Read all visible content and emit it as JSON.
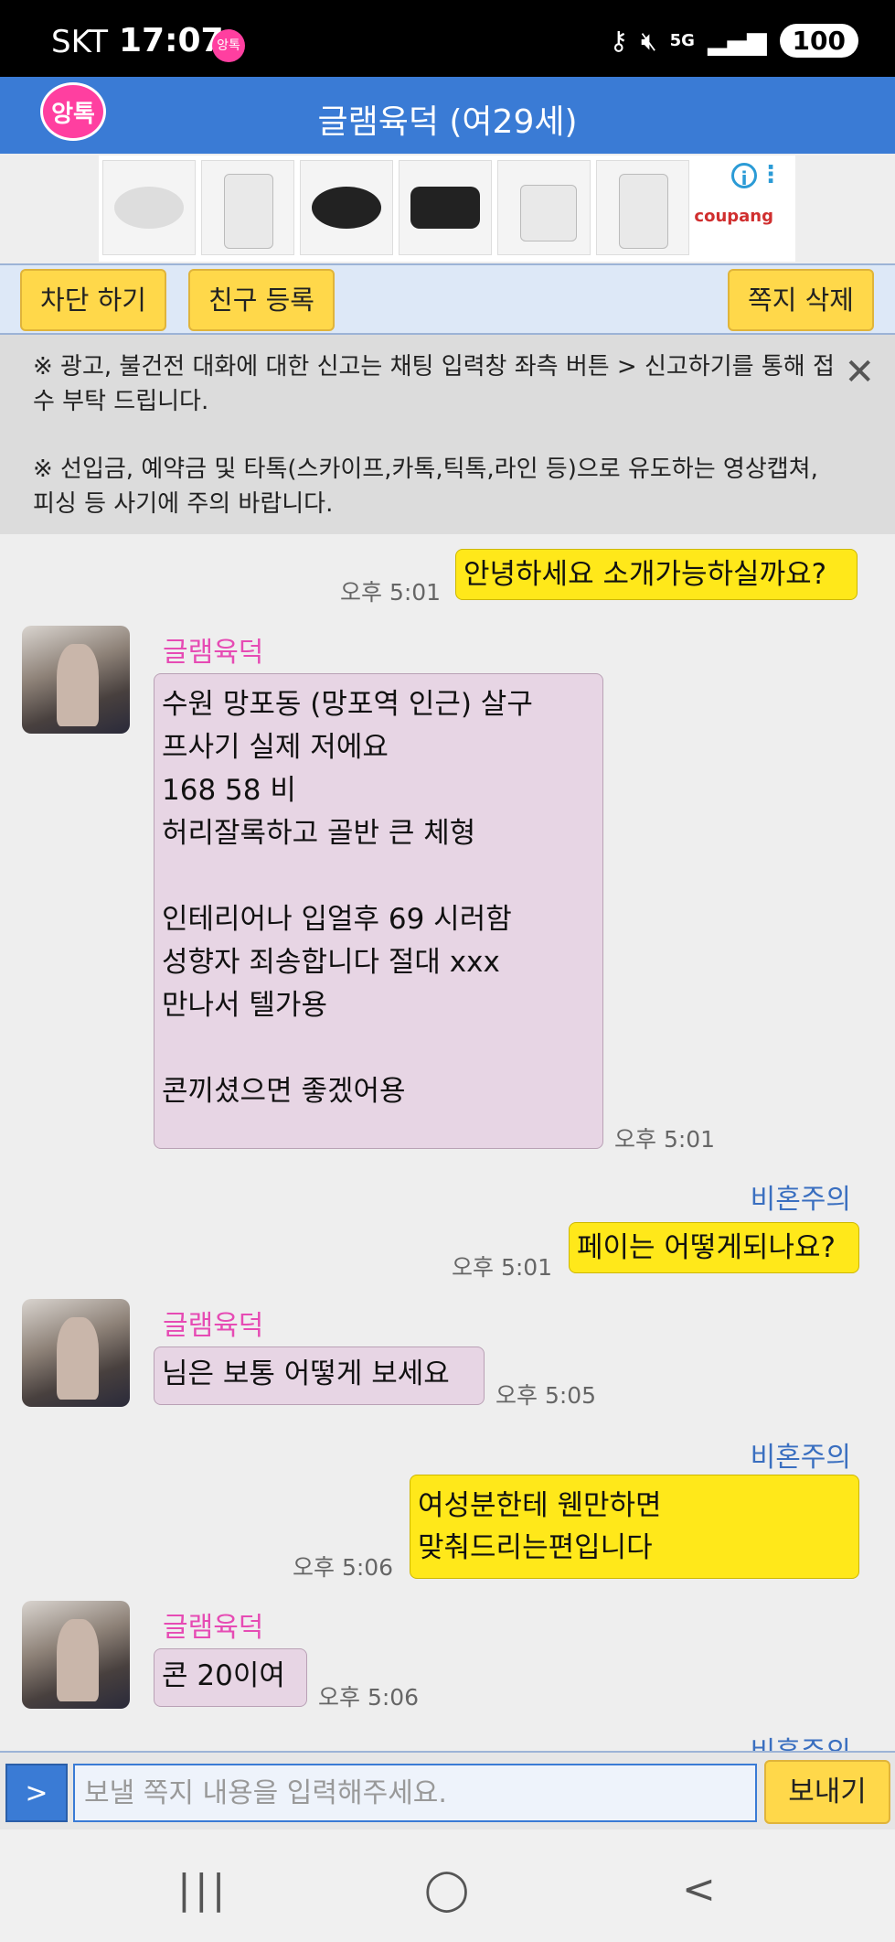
{
  "status_bar": {
    "carrier": "SKT",
    "time": "17:07",
    "app_icon_text": "앙톡",
    "network": "5G",
    "battery": "100"
  },
  "header": {
    "logo_text": "앙톡",
    "title": "글램육덕 (여29세)"
  },
  "ad": {
    "brand": "coupang",
    "info_symbol": "i"
  },
  "actions": {
    "block": "차단 하기",
    "add_friend": "친구 등록",
    "delete_note": "쪽지 삭제"
  },
  "notice": {
    "line1": "※ 광고, 불건전 대화에 대한 신고는 채팅 입력창 좌측 버튼 > 신고하기를 통해 접수 부탁 드립니다.",
    "line2": "※ 선입금, 예약금 및 타톡(스카이프,카톡,틱톡,라인 등)으로 유도하는 영상캡쳐,피싱 등 사기에 주의 바랍니다."
  },
  "messages": {
    "m1": {
      "text": "안녕하세요 소개가능하실까요?",
      "time": "오후 5:01"
    },
    "m2": {
      "sender": "글램육덕",
      "text": "수원 망포동 (망포역 인근) 살구\n프사기 실제 저에요\n168 58 비\n허리잘록하고 골반 큰 체형\n\n인테리어나 입얼후 69 시러함\n성향자 죄송합니다 절대 xxx\n만나서 텔가용\n\n콘끼셨으면 좋겠어용",
      "time": "오후 5:01"
    },
    "m3": {
      "sender": "비혼주의",
      "text": "페이는 어떻게되나요?",
      "time": "오후 5:01"
    },
    "m4": {
      "sender": "글램육덕",
      "text": "님은 보통 어떻게 보세요",
      "time": "오후 5:05"
    },
    "m5": {
      "sender": "비혼주의",
      "text_line1": "여성분한테 웬만하면",
      "text_line2": "맞춰드리는편입니다",
      "time": "오후 5:06"
    },
    "m6": {
      "sender": "글램육덕",
      "text": "콘 20이여",
      "time": "오후 5:06"
    },
    "m7": {
      "sender": "비혼주의"
    }
  },
  "input": {
    "more_label": ">",
    "placeholder": "보낼 쪽지 내용을 입력해주세요.",
    "send_label": "보내기"
  },
  "nav": {
    "recents": "|||",
    "home": "◯",
    "back": "<"
  }
}
